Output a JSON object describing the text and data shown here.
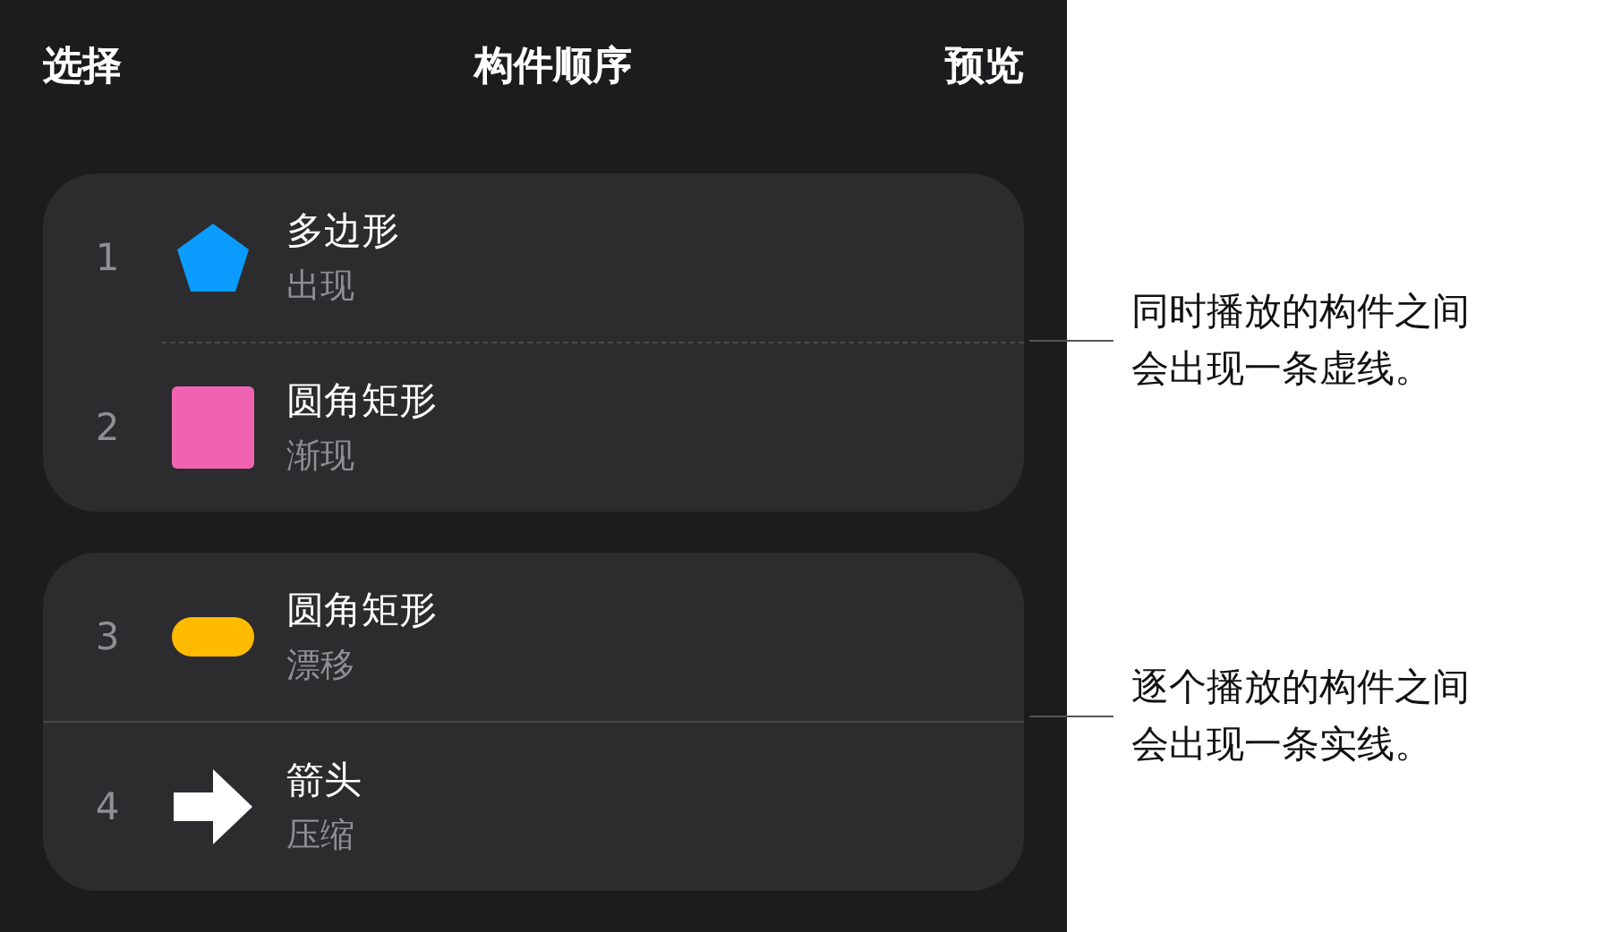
{
  "header": {
    "left": "选择",
    "title": "构件顺序",
    "right": "预览"
  },
  "groups": [
    {
      "kind": "dashed",
      "items": [
        {
          "number": "1",
          "name": "多边形",
          "effect": "出现",
          "kind": "pentagon",
          "color": "#0a9cff"
        },
        {
          "number": "2",
          "name": "圆角矩形",
          "effect": "渐现",
          "kind": "square",
          "color": "#f063b0"
        }
      ]
    },
    {
      "kind": "solid",
      "items": [
        {
          "number": "3",
          "name": "圆角矩形",
          "effect": "漂移",
          "kind": "capsule",
          "color": "#ffbb00"
        },
        {
          "number": "4",
          "name": "箭头",
          "effect": "压缩",
          "kind": "arrow",
          "color": "#ffffff"
        }
      ]
    }
  ],
  "callouts": [
    {
      "text": "同时播放的构件之间会出现一条虚线。"
    },
    {
      "text": "逐个播放的构件之间会出现一条实线。"
    }
  ]
}
